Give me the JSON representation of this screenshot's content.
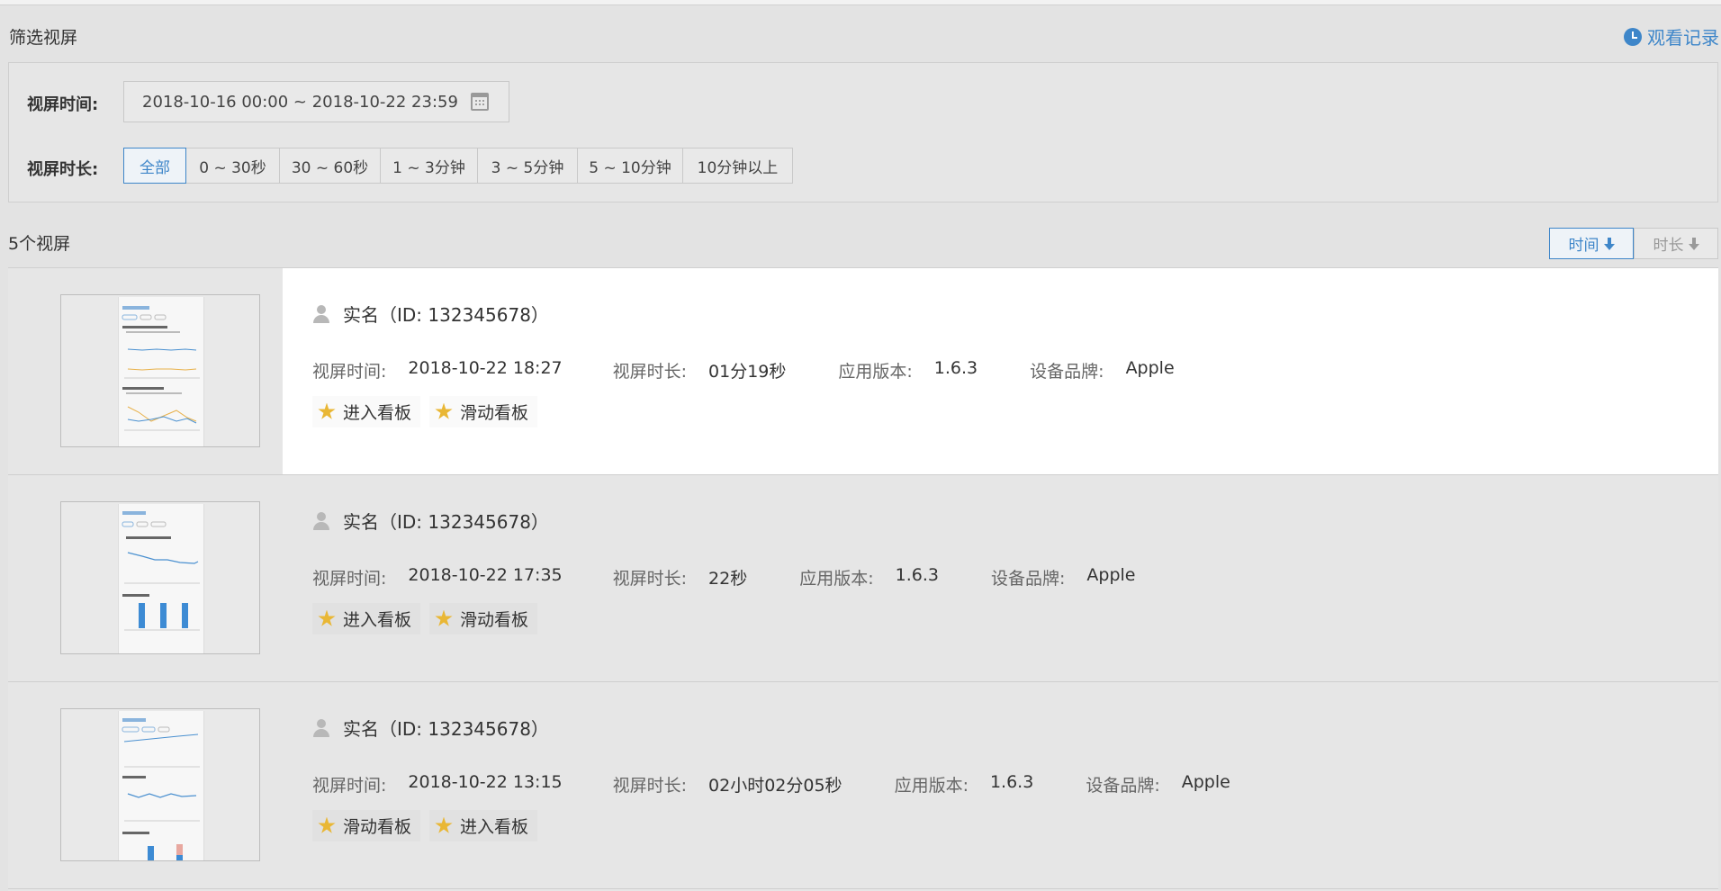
{
  "filter": {
    "title": "筛选视屏",
    "watch_history": "观看记录",
    "time_label": "视屏时间:",
    "date_range": "2018-10-16 00:00  ~ 2018-10-22 23:59",
    "duration_label": "视屏时长:",
    "durations": [
      "全部",
      "0 ~ 30秒",
      "30 ~ 60秒",
      "1 ~ 3分钟",
      "3 ~ 5分钟",
      "5 ~ 10分钟",
      "10分钟以上"
    ],
    "active_duration": "全部"
  },
  "list": {
    "count_label": "5个视屏",
    "sort": {
      "time": "时间",
      "duration": "时长",
      "active": "time"
    },
    "keys": {
      "time": "视屏时间:",
      "duration": "视屏时长:",
      "version": "应用版本:",
      "brand": "设备品牌:"
    },
    "rows": [
      {
        "user": "实名（ID: 132345678）",
        "time": "2018-10-22 18:27",
        "duration": "01分19秒",
        "version": "1.6.3",
        "brand": "Apple",
        "tags": [
          "进入看板",
          "滑动看板"
        ]
      },
      {
        "user": "实名（ID: 132345678）",
        "time": "2018-10-22 17:35",
        "duration": "22秒",
        "version": "1.6.3",
        "brand": "Apple",
        "tags": [
          "进入看板",
          "滑动看板"
        ]
      },
      {
        "user": "实名（ID: 132345678）",
        "time": "2018-10-22 13:15",
        "duration": "02小时02分05秒",
        "version": "1.6.3",
        "brand": "Apple",
        "tags": [
          "滑动看板",
          "进入看板"
        ]
      }
    ]
  },
  "colors": {
    "accent": "#3e86c9",
    "star": "#e9b735",
    "selected_row": "#ffffff"
  },
  "icons": {
    "history": "clock-icon",
    "date": "calendar-icon",
    "user": "user-icon",
    "tag": "star-icon",
    "sort": "arrow-down-icon"
  }
}
